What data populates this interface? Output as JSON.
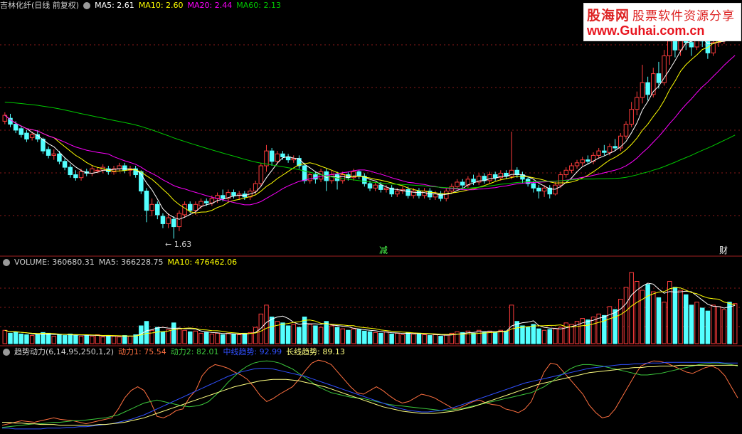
{
  "header_main": {
    "stock_name": "吉林化纤(日线 前复权)",
    "ma5": "MA5: 2.61",
    "ma10": "MA10: 2.60",
    "ma20": "MA20: 2.44",
    "ma60": "MA60: 2.13"
  },
  "header_volume": {
    "volume": "VOLUME: 360680.31",
    "ma5": "MA5: 366228.75",
    "ma10": "MA10: 476462.06"
  },
  "header_indicator": {
    "name": "趋势动力(6,14,95,250,1,2)",
    "d1": "动力1: 75.54",
    "d2": "动力2: 82.01",
    "mid": "中线趋势: 92.99",
    "long": "长线趋势: 89.13"
  },
  "logo": {
    "brand": "股海网",
    "slogan": "股票软件资源分享",
    "url": "www.Guhai.com.cn"
  },
  "annotations": {
    "low_label": "1.63",
    "signal_reduce": "减",
    "signal_finance": "财"
  },
  "colors": {
    "up": "#ff3c3c",
    "down": "#54ffff",
    "ma5": "#ffffff",
    "ma10": "#ffff00",
    "ma20": "#ff00ff",
    "ma60": "#00c800",
    "grid": "#8b1a1a",
    "d1": "#ff7040",
    "d2": "#3cc83c",
    "mid": "#3050ff",
    "long": "#ffff80"
  },
  "chart_data": {
    "type": "candlestick",
    "price_range": [
      1.55,
      3.15
    ],
    "low_point": 1.63,
    "candles": [
      [
        2.42,
        2.46,
        2.4,
        2.48
      ],
      [
        2.44,
        2.4,
        2.38,
        2.47
      ],
      [
        2.4,
        2.36,
        2.34,
        2.42
      ],
      [
        2.37,
        2.33,
        2.31,
        2.39
      ],
      [
        2.34,
        2.3,
        2.28,
        2.36
      ],
      [
        2.31,
        2.33,
        2.29,
        2.35
      ],
      [
        2.33,
        2.3,
        2.28,
        2.36
      ],
      [
        2.3,
        2.22,
        2.2,
        2.31
      ],
      [
        2.23,
        2.19,
        2.17,
        2.25
      ],
      [
        2.19,
        2.2,
        2.16,
        2.23
      ],
      [
        2.2,
        2.15,
        2.13,
        2.22
      ],
      [
        2.15,
        2.11,
        2.09,
        2.17
      ],
      [
        2.11,
        2.06,
        2.04,
        2.13
      ],
      [
        2.06,
        2.04,
        2.02,
        2.09
      ],
      [
        2.04,
        2.08,
        2.02,
        2.1
      ],
      [
        2.08,
        2.07,
        2.05,
        2.1
      ],
      [
        2.07,
        2.1,
        2.05,
        2.12
      ],
      [
        2.09,
        2.09,
        2.07,
        2.11
      ],
      [
        2.09,
        2.11,
        2.07,
        2.13
      ],
      [
        2.1,
        2.08,
        2.06,
        2.12
      ],
      [
        2.08,
        2.1,
        2.06,
        2.12
      ],
      [
        2.1,
        2.12,
        2.08,
        2.14
      ],
      [
        2.12,
        2.09,
        2.07,
        2.14
      ],
      [
        2.09,
        2.1,
        2.05,
        2.12
      ],
      [
        2.1,
        2.06,
        2.04,
        2.12
      ],
      [
        2.08,
        1.95,
        1.93,
        2.09
      ],
      [
        1.95,
        1.82,
        1.74,
        1.97
      ],
      [
        1.82,
        1.86,
        1.78,
        1.9
      ],
      [
        1.86,
        1.79,
        1.76,
        1.88
      ],
      [
        1.78,
        1.73,
        1.7,
        1.8
      ],
      [
        1.73,
        1.77,
        1.7,
        1.8
      ],
      [
        1.76,
        1.71,
        1.63,
        1.78
      ],
      [
        1.71,
        1.8,
        1.68,
        1.82
      ],
      [
        1.79,
        1.86,
        1.77,
        1.88
      ],
      [
        1.86,
        1.82,
        1.8,
        1.88
      ],
      [
        1.82,
        1.86,
        1.79,
        1.88
      ],
      [
        1.85,
        1.88,
        1.83,
        1.9
      ],
      [
        1.88,
        1.87,
        1.85,
        1.9
      ],
      [
        1.87,
        1.9,
        1.85,
        1.92
      ],
      [
        1.9,
        1.92,
        1.87,
        1.94
      ],
      [
        1.92,
        1.9,
        1.88,
        1.96
      ],
      [
        1.9,
        1.94,
        1.88,
        1.96
      ],
      [
        1.94,
        1.92,
        1.9,
        1.96
      ],
      [
        1.92,
        1.93,
        1.89,
        1.95
      ],
      [
        1.93,
        1.91,
        1.89,
        1.95
      ],
      [
        1.91,
        1.95,
        1.89,
        1.97
      ],
      [
        1.95,
        2.0,
        1.93,
        2.02
      ],
      [
        2.0,
        2.12,
        1.98,
        2.14
      ],
      [
        2.12,
        2.22,
        2.08,
        2.26
      ],
      [
        2.22,
        2.15,
        2.12,
        2.24
      ],
      [
        2.15,
        2.2,
        2.13,
        2.22
      ],
      [
        2.2,
        2.18,
        2.16,
        2.22
      ],
      [
        2.18,
        2.16,
        2.14,
        2.2
      ],
      [
        2.16,
        2.17,
        2.14,
        2.19
      ],
      [
        2.17,
        2.12,
        2.1,
        2.19
      ],
      [
        2.12,
        2.02,
        2.0,
        2.14
      ],
      [
        2.02,
        2.06,
        2.0,
        2.08
      ],
      [
        2.06,
        2.03,
        2.0,
        2.08
      ],
      [
        2.03,
        2.08,
        2.01,
        2.1
      ],
      [
        2.08,
        2.02,
        1.95,
        2.1
      ],
      [
        2.02,
        2.06,
        2.0,
        2.09
      ],
      [
        2.06,
        2.02,
        1.96,
        2.08
      ],
      [
        2.02,
        2.06,
        2.0,
        2.08
      ],
      [
        2.06,
        2.04,
        2.02,
        2.08
      ],
      [
        2.04,
        2.08,
        2.02,
        2.1
      ],
      [
        2.08,
        2.05,
        2.03,
        2.09
      ],
      [
        2.05,
        2.0,
        1.98,
        2.07
      ],
      [
        2.0,
        1.97,
        1.95,
        2.02
      ],
      [
        1.97,
        1.99,
        1.95,
        2.01
      ],
      [
        1.99,
        1.96,
        1.94,
        2.01
      ],
      [
        1.96,
        1.97,
        1.94,
        1.99
      ],
      [
        1.97,
        1.93,
        1.91,
        1.99
      ],
      [
        1.93,
        1.95,
        1.91,
        1.97
      ],
      [
        1.95,
        1.96,
        1.93,
        1.98
      ],
      [
        1.96,
        1.92,
        1.9,
        1.98
      ],
      [
        1.92,
        1.95,
        1.9,
        1.97
      ],
      [
        1.95,
        1.92,
        1.9,
        1.97
      ],
      [
        1.92,
        1.95,
        1.9,
        1.97
      ],
      [
        1.95,
        1.91,
        1.89,
        1.97
      ],
      [
        1.91,
        1.93,
        1.89,
        1.95
      ],
      [
        1.93,
        1.9,
        1.88,
        1.95
      ],
      [
        1.9,
        1.95,
        1.88,
        1.97
      ],
      [
        1.95,
        1.98,
        1.93,
        2.0
      ],
      [
        1.98,
        2.01,
        1.96,
        2.03
      ],
      [
        2.01,
        1.99,
        1.97,
        2.03
      ],
      [
        1.99,
        2.03,
        1.97,
        2.05
      ],
      [
        2.03,
        2.01,
        1.99,
        2.06
      ],
      [
        2.01,
        2.05,
        1.99,
        2.07
      ],
      [
        2.05,
        2.02,
        2.0,
        2.07
      ],
      [
        2.02,
        2.06,
        2.0,
        2.08
      ],
      [
        2.06,
        2.04,
        2.02,
        2.08
      ],
      [
        2.04,
        2.07,
        2.02,
        2.09
      ],
      [
        2.07,
        2.05,
        2.03,
        2.09
      ],
      [
        2.05,
        2.09,
        2.03,
        2.35
      ],
      [
        2.09,
        2.06,
        2.04,
        2.11
      ],
      [
        2.06,
        2.03,
        2.0,
        2.08
      ],
      [
        2.03,
        2.0,
        1.98,
        2.05
      ],
      [
        2.0,
        1.97,
        1.94,
        2.02
      ],
      [
        1.97,
        1.95,
        1.9,
        1.99
      ],
      [
        1.95,
        1.97,
        1.91,
        1.99
      ],
      [
        1.97,
        1.93,
        1.9,
        1.99
      ],
      [
        1.93,
        1.99,
        1.92,
        2.01
      ],
      [
        1.99,
        2.06,
        1.97,
        2.08
      ],
      [
        2.06,
        2.09,
        2.04,
        2.11
      ],
      [
        2.09,
        2.12,
        2.07,
        2.14
      ],
      [
        2.12,
        2.14,
        2.1,
        2.16
      ],
      [
        2.14,
        2.16,
        2.12,
        2.18
      ],
      [
        2.16,
        2.15,
        2.13,
        2.19
      ],
      [
        2.15,
        2.19,
        2.13,
        2.21
      ],
      [
        2.19,
        2.22,
        2.17,
        2.24
      ],
      [
        2.22,
        2.21,
        2.19,
        2.26
      ],
      [
        2.21,
        2.25,
        2.19,
        2.27
      ],
      [
        2.25,
        2.24,
        2.22,
        2.3
      ],
      [
        2.24,
        2.32,
        2.22,
        2.34
      ],
      [
        2.32,
        2.4,
        2.3,
        2.42
      ],
      [
        2.4,
        2.5,
        2.38,
        2.55
      ],
      [
        2.5,
        2.58,
        2.46,
        2.62
      ],
      [
        2.58,
        2.68,
        2.54,
        2.8
      ],
      [
        2.68,
        2.6,
        2.56,
        2.72
      ],
      [
        2.6,
        2.74,
        2.58,
        2.78
      ],
      [
        2.74,
        2.68,
        2.64,
        2.82
      ],
      [
        2.68,
        2.86,
        2.66,
        2.9
      ],
      [
        2.86,
        2.96,
        2.8,
        3.02
      ],
      [
        2.96,
        2.9,
        2.85,
        3.05
      ],
      [
        2.9,
        3.06,
        2.86,
        3.1
      ],
      [
        3.06,
        2.95,
        2.9,
        3.08
      ],
      [
        2.95,
        2.92,
        2.86,
        3.0
      ],
      [
        2.92,
        3.0,
        2.9,
        3.05
      ],
      [
        3.0,
        2.96,
        2.92,
        3.06
      ],
      [
        2.96,
        2.88,
        2.84,
        3.0
      ],
      [
        2.88,
        2.95,
        2.86,
        3.0
      ],
      [
        2.95,
        2.98,
        2.92,
        3.04
      ],
      [
        2.98,
        3.02,
        2.94,
        3.06
      ],
      [
        3.02,
        3.0,
        2.96,
        3.06
      ],
      [
        3.0,
        3.04,
        2.98,
        3.08
      ]
    ],
    "ma_series": [
      {
        "name": "MA5",
        "color_key": "ma5"
      },
      {
        "name": "MA10",
        "color_key": "ma10"
      },
      {
        "name": "MA20",
        "color_key": "ma20"
      },
      {
        "name": "MA60",
        "color_key": "ma60"
      }
    ],
    "volume": [
      90,
      70,
      80,
      65,
      60,
      55,
      60,
      75,
      70,
      50,
      60,
      55,
      65,
      60,
      50,
      55,
      50,
      60,
      45,
      55,
      50,
      45,
      55,
      50,
      60,
      120,
      150,
      90,
      110,
      80,
      95,
      140,
      100,
      90,
      80,
      85,
      70,
      75,
      65,
      70,
      60,
      70,
      65,
      60,
      70,
      75,
      110,
      200,
      260,
      180,
      150,
      140,
      120,
      130,
      110,
      180,
      130,
      120,
      110,
      150,
      120,
      110,
      100,
      90,
      100,
      95,
      85,
      80,
      75,
      70,
      80,
      65,
      70,
      60,
      75,
      65,
      70,
      60,
      55,
      60,
      50,
      60,
      70,
      80,
      75,
      85,
      70,
      90,
      80,
      85,
      75,
      90,
      85,
      260,
      150,
      120,
      110,
      130,
      100,
      90,
      95,
      100,
      110,
      140,
      130,
      150,
      170,
      160,
      180,
      200,
      190,
      250,
      230,
      300,
      380,
      480,
      420,
      360,
      400,
      350,
      310,
      280,
      420,
      380,
      360,
      330,
      260,
      280,
      240,
      220,
      260,
      250,
      230,
      280,
      270
    ],
    "indicator_series": [
      {
        "name": "动力1",
        "color_key": "d1",
        "values": [
          8,
          10,
          12,
          14,
          13,
          12,
          14,
          16,
          18,
          16,
          15,
          14,
          12,
          10,
          12,
          14,
          16,
          18,
          30,
          45,
          55,
          60,
          55,
          40,
          20,
          18,
          22,
          28,
          30,
          45,
          55,
          75,
          85,
          90,
          88,
          85,
          80,
          76,
          70,
          60,
          48,
          40,
          44,
          50,
          55,
          60,
          70,
          82,
          92,
          96,
          94,
          90,
          80,
          70,
          60,
          52,
          50,
          55,
          60,
          55,
          48,
          42,
          38,
          40,
          45,
          50,
          48,
          45,
          40,
          35,
          30,
          32,
          36,
          40,
          42,
          38,
          36,
          35,
          30,
          28,
          25,
          30,
          40,
          60,
          80,
          92,
          90,
          80,
          70,
          60,
          50,
          35,
          25,
          18,
          20,
          30,
          45,
          60,
          75,
          88,
          92,
          95,
          94,
          92,
          88,
          84,
          80,
          78,
          82,
          86,
          88,
          84,
          75,
          60,
          45
        ]
      },
      {
        "name": "动力2",
        "color_key": "d2",
        "values": [
          5,
          6,
          7,
          8,
          9,
          10,
          10,
          11,
          12,
          12,
          13,
          14,
          14,
          15,
          16,
          17,
          18,
          20,
          22,
          26,
          30,
          34,
          38,
          40,
          42,
          40,
          38,
          36,
          34,
          33,
          34,
          36,
          40,
          48,
          56,
          66,
          74,
          82,
          88,
          92,
          94,
          95,
          94,
          92,
          88,
          84,
          78,
          72,
          66,
          60,
          56,
          52,
          50,
          48,
          46,
          45,
          44,
          42,
          40,
          38,
          36,
          35,
          34,
          33,
          32,
          31,
          30,
          29,
          28,
          28,
          29,
          30,
          32,
          34,
          36,
          38,
          40,
          42,
          44,
          46,
          48,
          50,
          52,
          56,
          60,
          66,
          72,
          78,
          84,
          88,
          90,
          90,
          89,
          88,
          86,
          84,
          82,
          80,
          78,
          76,
          76,
          77,
          78,
          80,
          82,
          84,
          86,
          88,
          90,
          91,
          92,
          92,
          91,
          90,
          88
        ]
      },
      {
        "name": "中线趋势",
        "color_key": "mid",
        "values": [
          4,
          4,
          3,
          3,
          3,
          3,
          3,
          4,
          4,
          4,
          5,
          5,
          6,
          6,
          7,
          8,
          9,
          10,
          12,
          14,
          16,
          19,
          22,
          26,
          30,
          34,
          38,
          42,
          46,
          50,
          54,
          58,
          62,
          66,
          70,
          74,
          77,
          80,
          82,
          84,
          85,
          85,
          84,
          82,
          80,
          78,
          76,
          74,
          71,
          68,
          65,
          62,
          59,
          56,
          53,
          50,
          47,
          44,
          41,
          38,
          35,
          32,
          30,
          28,
          27,
          26,
          26,
          27,
          28,
          30,
          32,
          35,
          38,
          41,
          44,
          47,
          50,
          53,
          56,
          59,
          62,
          65,
          67,
          69,
          71,
          73,
          75,
          77,
          79,
          81,
          83,
          85,
          86,
          87,
          88,
          89,
          90,
          90,
          91,
          91,
          92,
          92,
          92,
          93,
          93,
          93,
          93,
          93,
          93,
          93,
          93,
          93,
          92,
          92,
          92
        ]
      },
      {
        "name": "长线趋势",
        "color_key": "long",
        "values": [
          12,
          12,
          11,
          11,
          10,
          10,
          9,
          9,
          9,
          8,
          8,
          8,
          8,
          8,
          8,
          9,
          9,
          10,
          11,
          12,
          14,
          16,
          18,
          21,
          24,
          27,
          30,
          33,
          36,
          39,
          42,
          45,
          48,
          51,
          54,
          57,
          60,
          62,
          64,
          66,
          68,
          69,
          70,
          70,
          70,
          69,
          68,
          66,
          64,
          62,
          60,
          57,
          54,
          51,
          48,
          45,
          42,
          39,
          36,
          33,
          31,
          29,
          27,
          26,
          25,
          24,
          24,
          24,
          25,
          26,
          27,
          29,
          31,
          33,
          36,
          39,
          42,
          45,
          48,
          51,
          54,
          57,
          60,
          63,
          65,
          67,
          69,
          71,
          73,
          75,
          77,
          79,
          80,
          81,
          82,
          83,
          84,
          85,
          86,
          86,
          87,
          87,
          88,
          88,
          88,
          89,
          89,
          89,
          89,
          89,
          89,
          89,
          89,
          89,
          89
        ]
      }
    ]
  }
}
